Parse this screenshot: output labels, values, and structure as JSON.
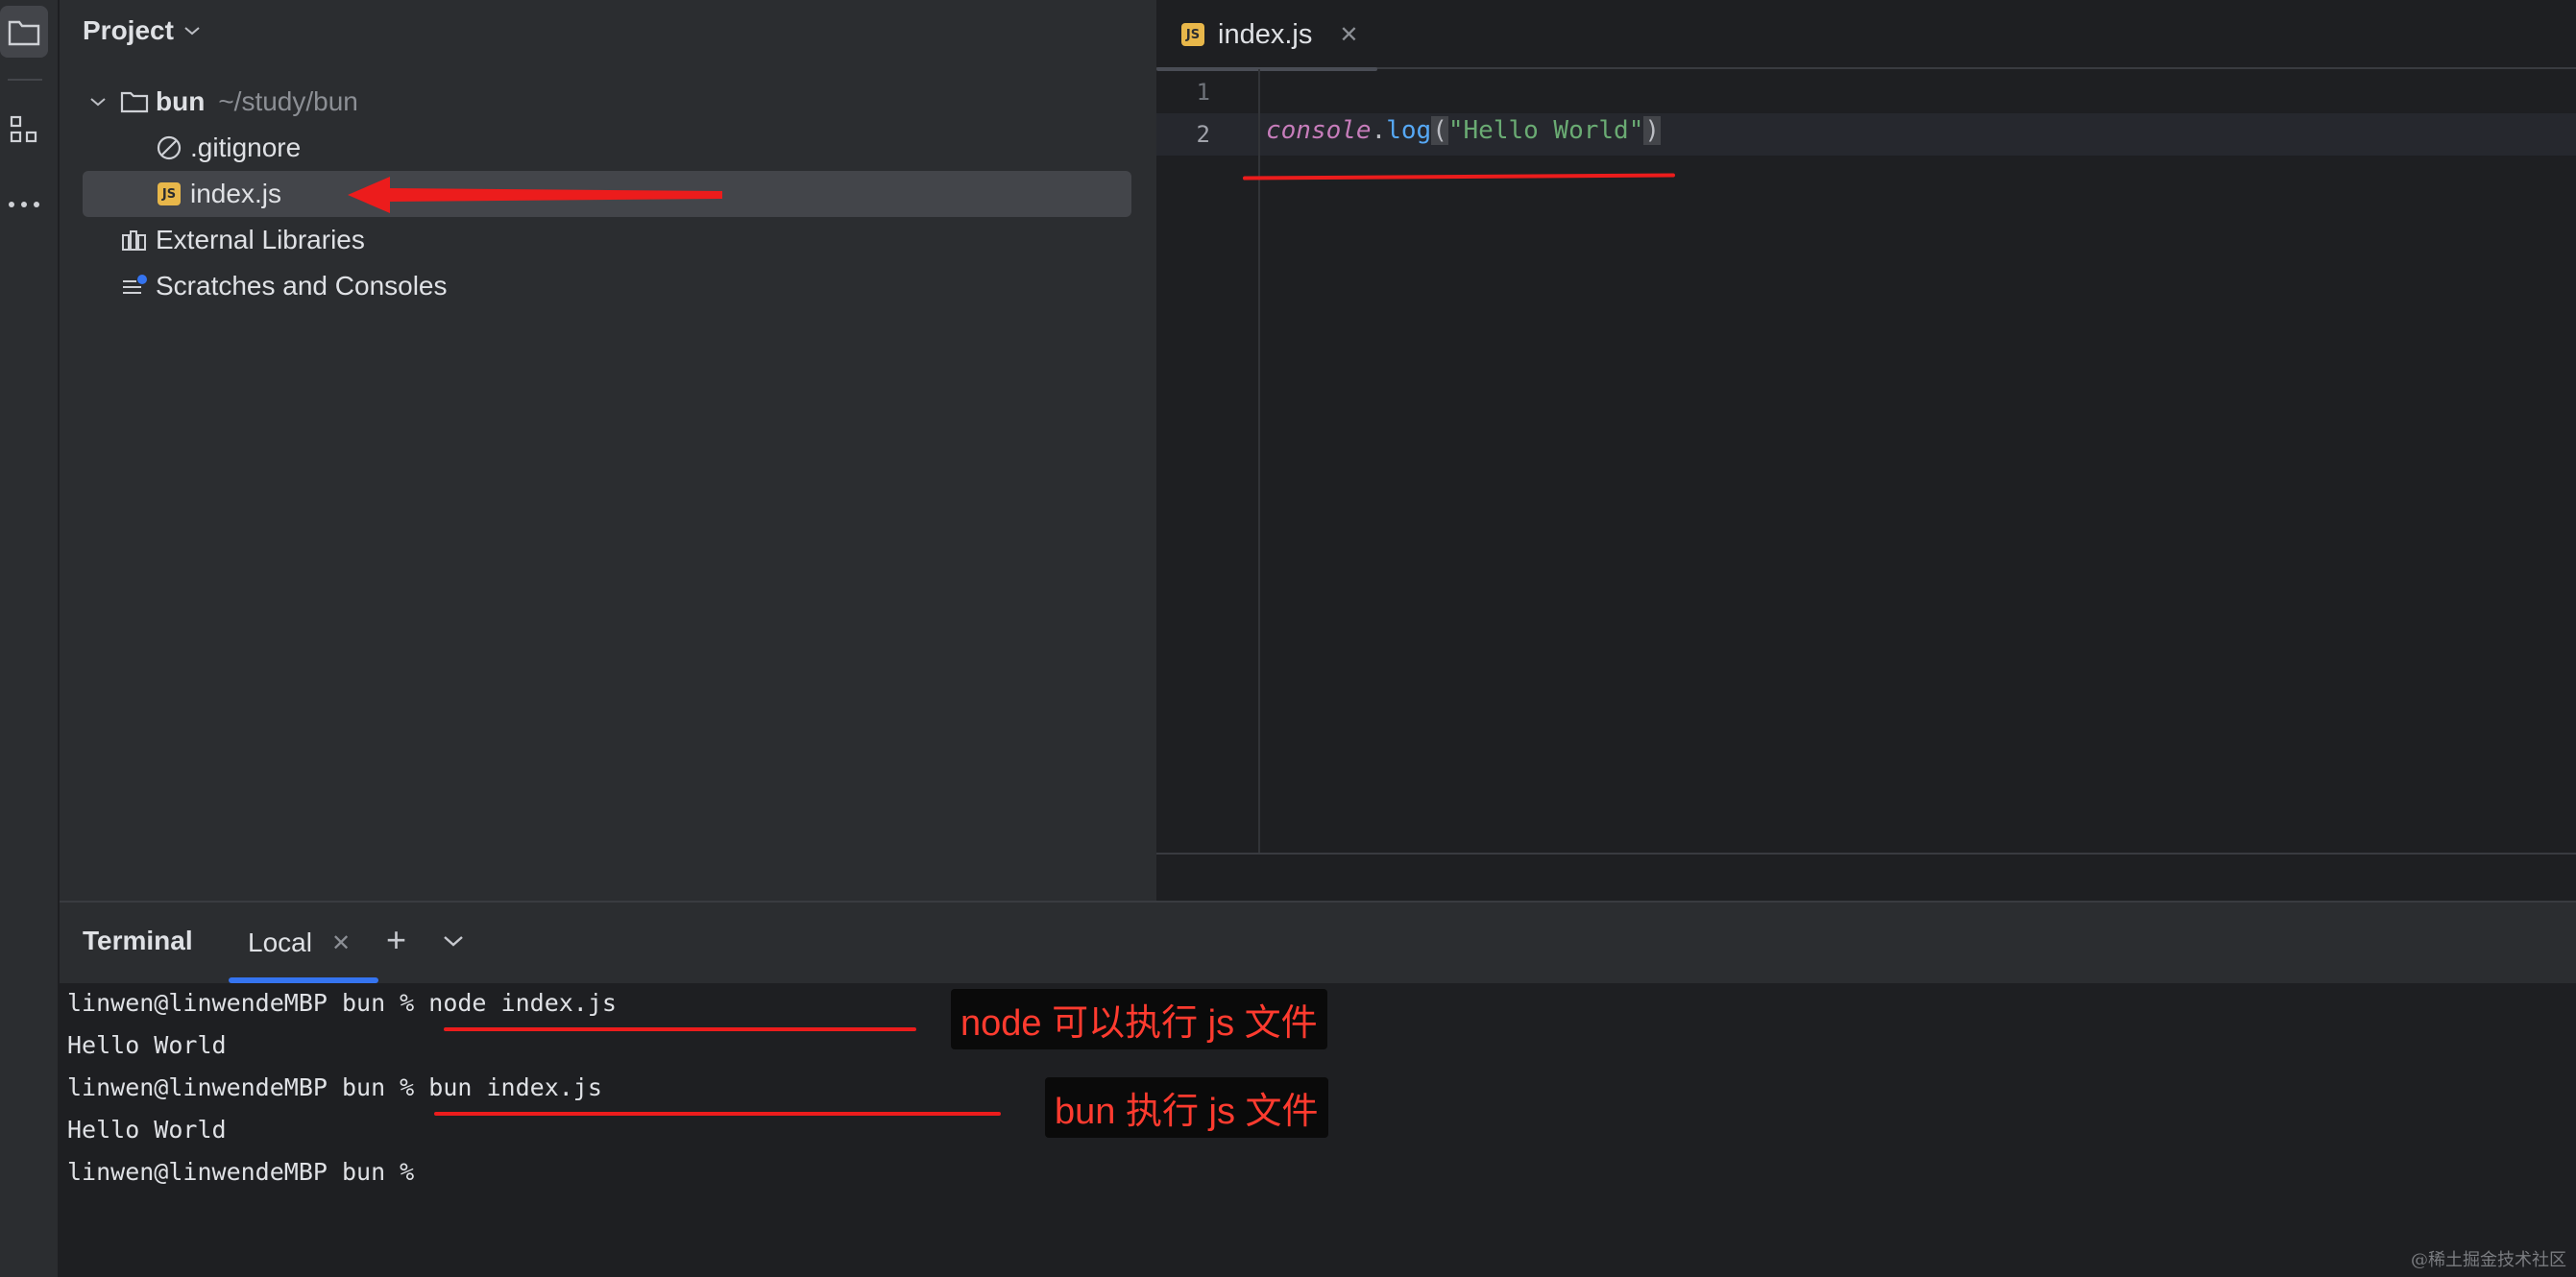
{
  "project": {
    "header_label": "Project",
    "tree": {
      "root_name": "bun",
      "root_path": "~/study/bun",
      "files": [
        ".gitignore",
        "index.js"
      ],
      "external_libraries": "External Libraries",
      "scratches": "Scratches and Consoles"
    }
  },
  "editor": {
    "tab_label": "index.js",
    "line_numbers": [
      "1",
      "2"
    ],
    "code": {
      "object": "console",
      "dot": ".",
      "method": "log",
      "open_paren": "(",
      "string": "\"Hello World\"",
      "close_paren": ")"
    }
  },
  "terminal": {
    "title": "Terminal",
    "tab_label": "Local",
    "lines": [
      "linwen@linwendeMBP bun % node index.js",
      "Hello World",
      "linwen@linwendeMBP bun % bun index.js",
      "Hello World",
      "linwen@linwendeMBP bun %"
    ]
  },
  "annotations": {
    "node_note": "node 可以执行 js 文件",
    "bun_note": "bun 执行 js 文件"
  },
  "watermark": "@稀土掘金技术社区",
  "colors": {
    "accent_blue": "#3574f0",
    "annotation_red": "#ec1c1c",
    "js_badge": "#e8b74a"
  }
}
